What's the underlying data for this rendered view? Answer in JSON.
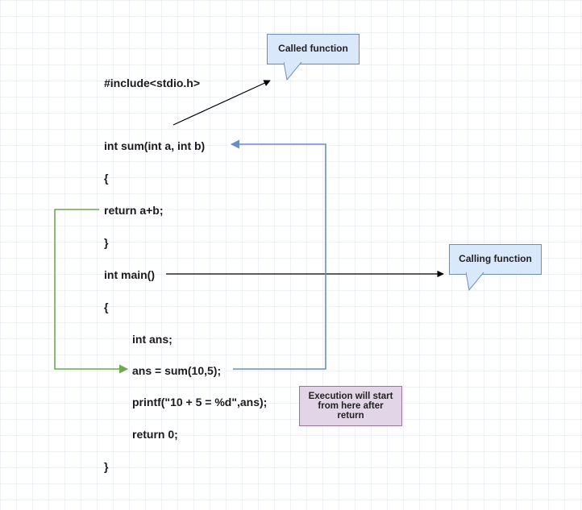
{
  "code": {
    "l1": "#include<stdio.h>",
    "l2": "int sum(int a, int b)",
    "l3": "{",
    "l4": "return a+b;",
    "l5": "}",
    "l6": "int main()",
    "l7": "{",
    "l8": "int ans;",
    "l9": "ans = sum(10,5);",
    "l10": "printf(\"10 + 5 = %d\",ans);",
    "l11": "return 0;",
    "l12": "}"
  },
  "labels": {
    "called": "Called function",
    "calling": "Calling function",
    "note": "Execution will start from here after return"
  }
}
